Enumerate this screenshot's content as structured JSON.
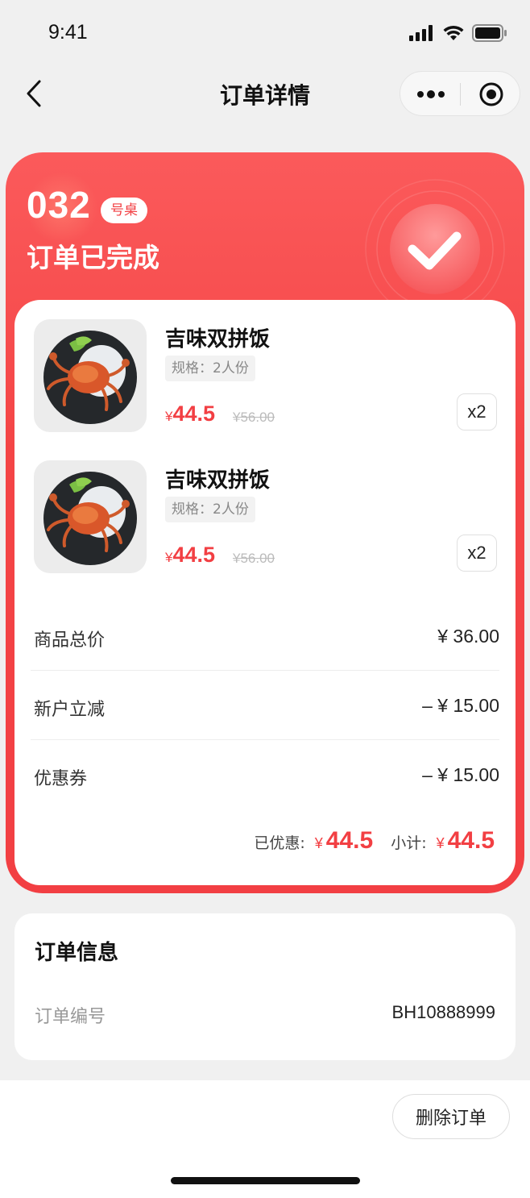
{
  "status_bar": {
    "time": "9:41"
  },
  "nav": {
    "title": "订单详情",
    "back_icon": "chevron-left-icon",
    "more_icon": "more-dots-icon",
    "close_icon": "target-circle-icon"
  },
  "order_header": {
    "table_number": "032",
    "table_suffix": "号桌",
    "status": "订单已完成",
    "status_icon": "check-circle-icon",
    "accent_color": "#f23f43"
  },
  "items": [
    {
      "name": "吉味双拼饭",
      "spec": "规格：2人份",
      "price_symbol": "¥",
      "price": "44.5",
      "original_price": "¥56.00",
      "quantity": "x2",
      "image": "crab-dish-image"
    },
    {
      "name": "吉味双拼饭",
      "spec": "规格：2人份",
      "price_symbol": "¥",
      "price": "44.5",
      "original_price": "¥56.00",
      "quantity": "x2",
      "image": "crab-dish-image"
    }
  ],
  "costs": [
    {
      "label": "商品总价",
      "value": "¥ 36.00"
    },
    {
      "label": "新户立减",
      "value": "– ¥ 15.00"
    },
    {
      "label": "优惠券",
      "value": "– ¥ 15.00"
    }
  ],
  "summary": {
    "discount_label": "已优惠:",
    "discount_symbol": "¥",
    "discount_value": "44.5",
    "subtotal_label": "小计:",
    "subtotal_symbol": "¥",
    "subtotal_value": "44.5"
  },
  "order_info": {
    "title": "订单信息",
    "number_label": "订单编号",
    "number_value": "BH10888999"
  },
  "actions": {
    "delete_label": "删除订单"
  }
}
